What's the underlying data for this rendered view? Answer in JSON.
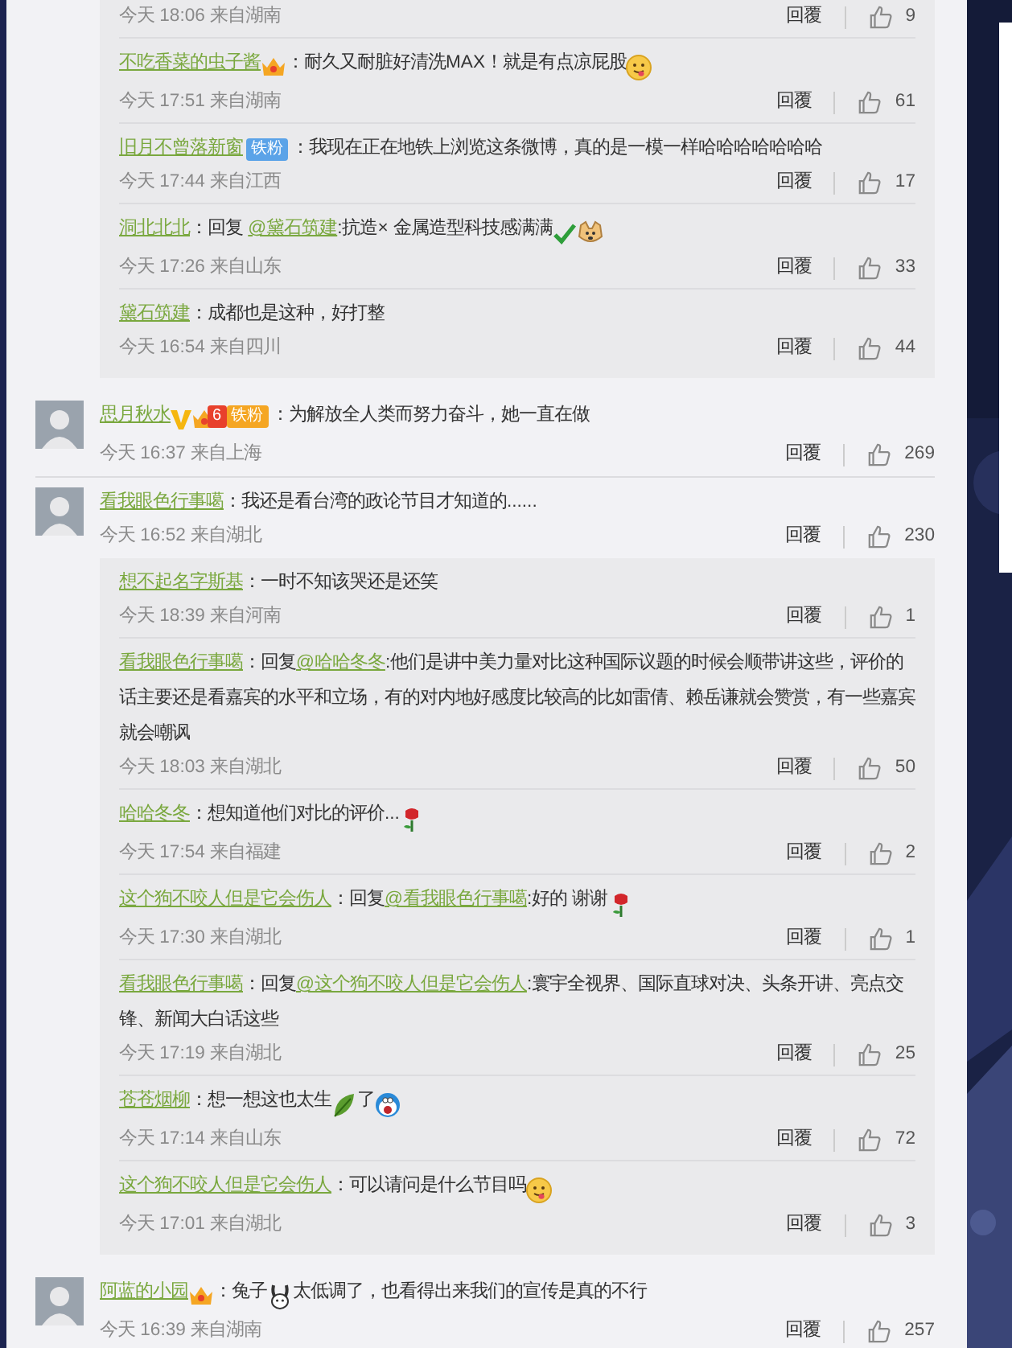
{
  "threads": [
    {
      "replies": [
        {
          "meta": "今天 18:06 来自湖南",
          "reply_label": "回覆",
          "likes": "9"
        },
        {
          "user": "不吃香菜的虫子酱",
          "badges": [
            {
              "kind": "vip"
            }
          ],
          "body": [
            {
              "kind": "text",
              "text": "：耐久又耐脏好清洗MAX！就是有点凉屁股"
            },
            {
              "kind": "smiley"
            }
          ],
          "meta": "今天 17:51 来自湖南",
          "reply_label": "回覆",
          "likes": "61"
        },
        {
          "user": "旧月不曾落新窗",
          "badges": [
            {
              "kind": "fan",
              "text": "铁粉",
              "color": "#5ba3e8"
            }
          ],
          "body": [
            {
              "kind": "text",
              "text": "：我现在正在地铁上浏览这条微博，真的是一模一样哈哈哈哈哈哈哈"
            }
          ],
          "meta": "今天 17:44 来自江西",
          "reply_label": "回覆",
          "likes": "17"
        },
        {
          "user": "洞北北北",
          "body": [
            {
              "kind": "text",
              "text": "：回复 "
            },
            {
              "kind": "mention",
              "text": "@黛石筑建"
            },
            {
              "kind": "text",
              "text": ":抗造× 金属造型科技感满满"
            },
            {
              "kind": "check"
            },
            {
              "kind": "dog"
            }
          ],
          "meta": "今天 17:26 来自山东",
          "reply_label": "回覆",
          "likes": "33"
        },
        {
          "user": "黛石筑建",
          "body": [
            {
              "kind": "text",
              "text": "：成都也是这种，好打整"
            }
          ],
          "meta": "今天 16:54 来自四川",
          "reply_label": "回覆",
          "likes": "44"
        }
      ]
    },
    {
      "user": "思月秋水",
      "badges": [
        {
          "kind": "verified"
        },
        {
          "kind": "fan",
          "text": "铁粉",
          "color": "#f5a623",
          "level": "6"
        }
      ],
      "body": [
        {
          "kind": "text",
          "text": "：为解放全人类而努力奋斗，她一直在做"
        }
      ],
      "meta": "今天 16:37 来自上海",
      "reply_label": "回覆",
      "likes": "269"
    },
    {
      "user": "看我眼色行事噶",
      "body": [
        {
          "kind": "text",
          "text": "：我还是看台湾的政论节目才知道的......"
        }
      ],
      "meta": "今天 16:52 来自湖北",
      "reply_label": "回覆",
      "likes": "230",
      "replies": [
        {
          "user": "想不起名字斯基",
          "body": [
            {
              "kind": "text",
              "text": "：一时不知该哭还是还笑"
            }
          ],
          "meta": "今天 18:39 来自河南",
          "reply_label": "回覆",
          "likes": "1"
        },
        {
          "user": "看我眼色行事噶",
          "body": [
            {
              "kind": "text",
              "text": "：回复"
            },
            {
              "kind": "mention",
              "text": "@哈哈冬冬"
            },
            {
              "kind": "text",
              "text": ":他们是讲中美力量对比这种国际议题的时候会顺带讲这些，评价的话主要还是看嘉宾的水平和立场，有的对内地好感度比较高的比如雷倩、赖岳谦就会赞赏，有一些嘉宾就会嘲讽"
            }
          ],
          "meta": "今天 18:03 来自湖北",
          "reply_label": "回覆",
          "likes": "50"
        },
        {
          "user": "哈哈冬冬",
          "body": [
            {
              "kind": "text",
              "text": "：想知道他们对比的评价..."
            },
            {
              "kind": "rose"
            }
          ],
          "meta": "今天 17:54 来自福建",
          "reply_label": "回覆",
          "likes": "2"
        },
        {
          "user": "这个狗不咬人但是它会伤人",
          "body": [
            {
              "kind": "text",
              "text": "：回复"
            },
            {
              "kind": "mention",
              "text": "@看我眼色行事噶"
            },
            {
              "kind": "text",
              "text": ":好的 谢谢"
            },
            {
              "kind": "rose"
            }
          ],
          "meta": "今天 17:30 来自湖北",
          "reply_label": "回覆",
          "likes": "1"
        },
        {
          "user": "看我眼色行事噶",
          "body": [
            {
              "kind": "text",
              "text": "：回复"
            },
            {
              "kind": "mention",
              "text": "@这个狗不咬人但是它会伤人"
            },
            {
              "kind": "text",
              "text": ":寰宇全视界、国际直球对决、头条开讲、亮点交锋、新闻大白话这些"
            }
          ],
          "meta": "今天 17:19 来自湖北",
          "reply_label": "回覆",
          "likes": "25"
        },
        {
          "user": "苍苍烟柳",
          "body": [
            {
              "kind": "text",
              "text": "：想一想这也太生"
            },
            {
              "kind": "leaf"
            },
            {
              "kind": "text",
              "text": "了"
            },
            {
              "kind": "cartoon"
            }
          ],
          "meta": "今天 17:14 来自山东",
          "reply_label": "回覆",
          "likes": "72"
        },
        {
          "user": "这个狗不咬人但是它会伤人",
          "body": [
            {
              "kind": "text",
              "text": "：可以请问是什么节目吗"
            },
            {
              "kind": "smiley"
            }
          ],
          "meta": "今天 17:01 来自湖北",
          "reply_label": "回覆",
          "likes": "3"
        }
      ]
    },
    {
      "user": "阿蓝的小园",
      "badges": [
        {
          "kind": "vip"
        }
      ],
      "body": [
        {
          "kind": "text",
          "text": "：兔子"
        },
        {
          "kind": "rabbit"
        },
        {
          "kind": "text",
          "text": "太低调了，也看得出来我们的宣传是真的不行"
        }
      ],
      "meta": "今天 16:39 来自湖南",
      "reply_label": "回覆",
      "likes": "257"
    }
  ]
}
